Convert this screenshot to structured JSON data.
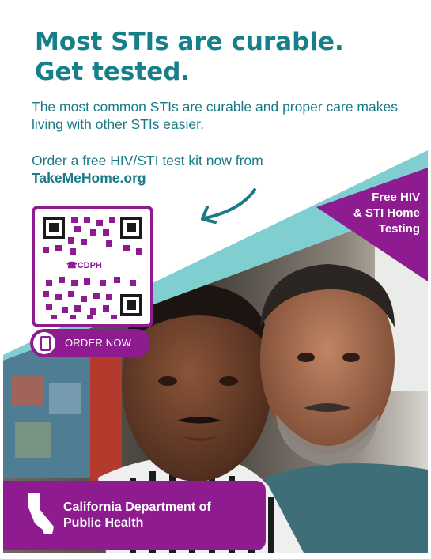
{
  "headline": {
    "line1": "Most STIs are curable.",
    "line2": "Get tested."
  },
  "subtext": "The most common STIs are curable and proper care makes living with other STIs easier.",
  "order": {
    "text": "Order a free HIV/STI test kit now from",
    "link": "TakeMeHome.org"
  },
  "badge": {
    "line1": "Free HIV",
    "line2": "& STI Home",
    "line3": "Testing"
  },
  "qr": {
    "center_label": "☎CDPH"
  },
  "order_button": {
    "label": "ORDER NOW",
    "icon": "phone-icon"
  },
  "footer": {
    "line1": "California Department of",
    "line2": "Public Health",
    "icon": "california-icon"
  },
  "colors": {
    "teal": "#157f8a",
    "light_teal": "#7fcfd0",
    "purple": "#8e1b90"
  }
}
